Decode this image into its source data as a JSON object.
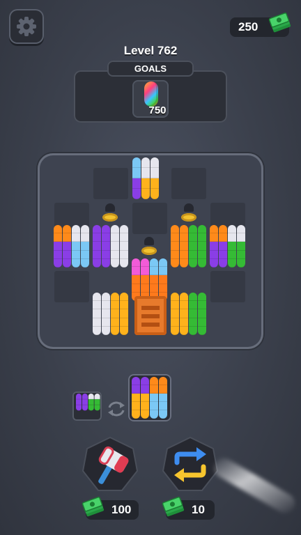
{
  "header": {
    "settings_icon": "gear-icon",
    "coins": "250",
    "coins_icon": "cash-stack-icon"
  },
  "level": {
    "title": "Level 762",
    "goals_label": "GOALS",
    "goal_item": "rainbow-capsule",
    "goal_count": "750"
  },
  "colors": {
    "purple": "#8a3ee6",
    "white": "#e6e6ee",
    "orange": "#ff8a1a",
    "yellow": "#ffb21c",
    "blue": "#7bc8f5",
    "green": "#35bb35",
    "pink": "#f25bd8",
    "deep_orange": "#ff7a1c"
  },
  "board": {
    "locked_slots": 3,
    "crate_slots": 1
  },
  "next": {
    "swap_icon": "swap-arrows-icon"
  },
  "boosters": [
    {
      "name": "hammer",
      "icon": "hammer-icon",
      "price": "100"
    },
    {
      "name": "shuffle",
      "icon": "shuffle-arrows-icon",
      "price": "10"
    }
  ]
}
